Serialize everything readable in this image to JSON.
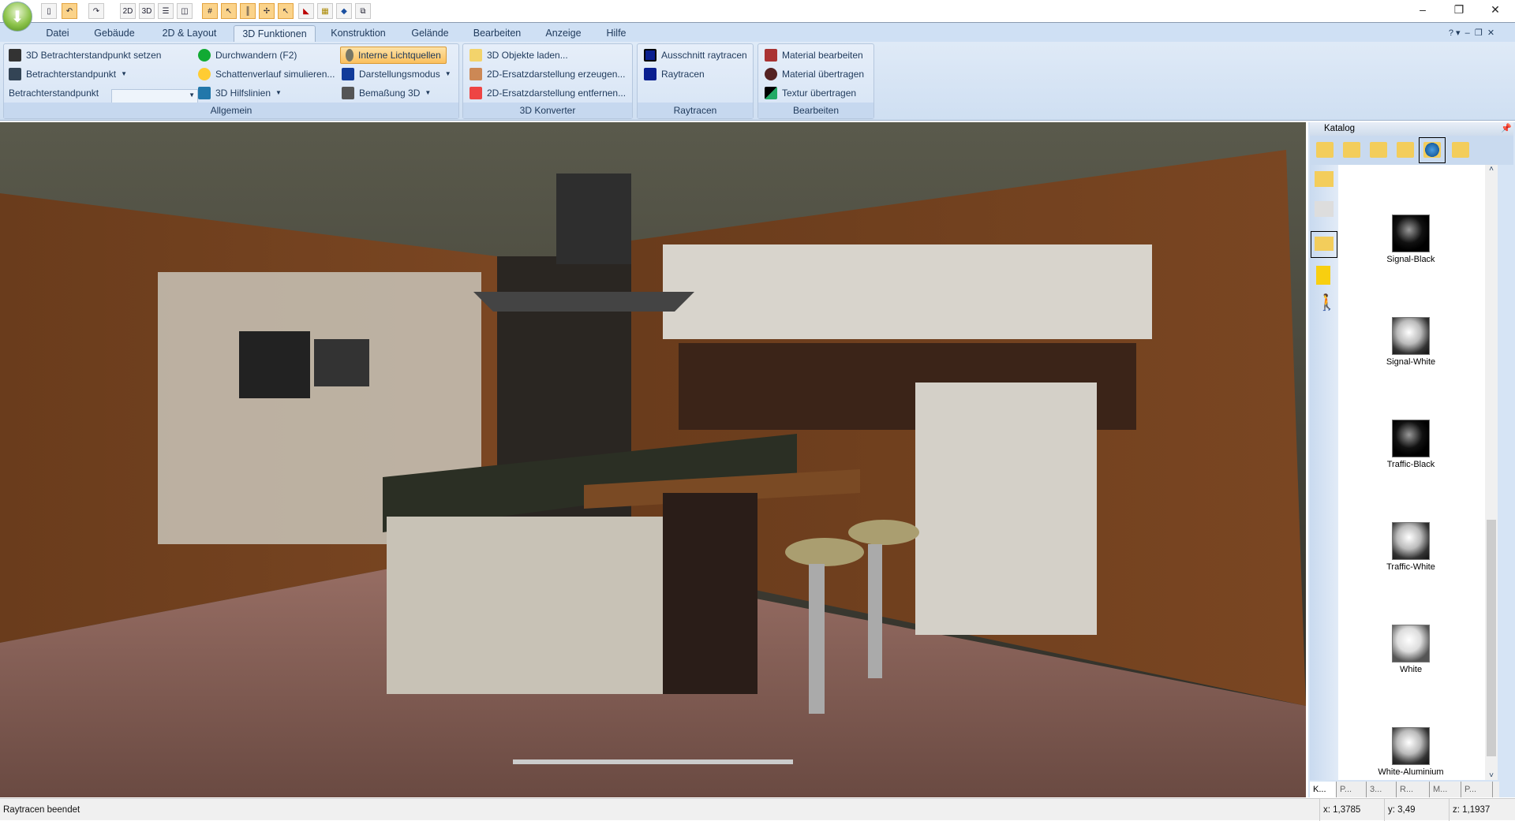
{
  "quick_access": {
    "icons": [
      "new-document-icon",
      "undo-icon",
      "redo-icon",
      "view-2d-icon",
      "view-3d-icon",
      "horizontal-split-icon",
      "vertical-split-icon",
      "grid-icon",
      "select-cursor-icon",
      "columns-icon",
      "snap-icon",
      "pointer-icon",
      "wall-icon",
      "roof-icon",
      "eraser-icon",
      "copy-icon"
    ],
    "labels": {
      "2d": "2D",
      "3d": "3D"
    }
  },
  "window_controls": {
    "minimize": "–",
    "restore": "❐",
    "close": "✕"
  },
  "tabs": [
    {
      "label": "Datei"
    },
    {
      "label": "Gebäude"
    },
    {
      "label": "2D & Layout"
    },
    {
      "label": "3D Funktionen",
      "active": true
    },
    {
      "label": "Konstruktion"
    },
    {
      "label": "Gelände"
    },
    {
      "label": "Bearbeiten"
    },
    {
      "label": "Anzeige"
    },
    {
      "label": "Hilfe"
    }
  ],
  "ribbon": {
    "allgemein": {
      "label": "Allgemein",
      "items": [
        "3D Betrachterstandpunkt setzen",
        "Betrachterstandpunkt",
        "Betrachterstandpunkt",
        "Durchwandern (F2)",
        "Schattenverlauf simulieren...",
        "3D Hilfslinien",
        "Interne Lichtquellen",
        "Darstellungsmodus",
        "Bemaßung 3D"
      ],
      "combo_value": ""
    },
    "konverter": {
      "label": "3D Konverter",
      "items": [
        "3D Objekte laden...",
        "2D-Ersatzdarstellung erzeugen...",
        "2D-Ersatzdarstellung entfernen..."
      ]
    },
    "raytracen": {
      "label": "Raytracen",
      "items": [
        "Ausschnitt raytracen",
        "Raytracen"
      ]
    },
    "bearbeiten": {
      "label": "Bearbeiten",
      "items": [
        "Material bearbeiten",
        "Material übertragen",
        "Textur übertragen"
      ]
    }
  },
  "accent": {
    "active_item": "#fbc05d",
    "ribbon": "#dfeaf7"
  },
  "catalog": {
    "title": "Katalog",
    "items": [
      "Signal-Black",
      "Signal-White",
      "Traffic-Black",
      "Traffic-White",
      "White",
      "White-Aluminium"
    ],
    "bottom_tabs": [
      "K...",
      "P...",
      "3...",
      "R...",
      "M...",
      "P..."
    ]
  },
  "status": {
    "message": "Raytracen beendet",
    "x": "x: 1,3785",
    "y": "y: 3,49",
    "z": "z: 1,1937"
  }
}
